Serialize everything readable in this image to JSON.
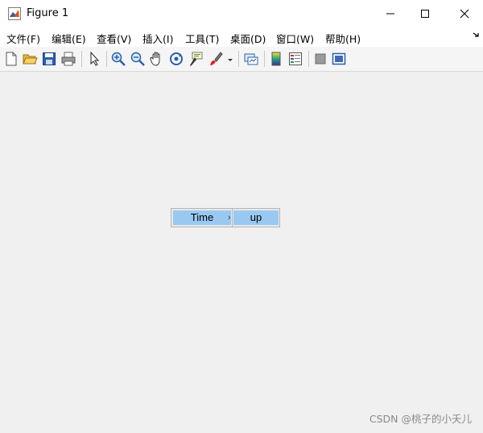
{
  "window": {
    "title": "Figure 1",
    "controls": [
      "minimize",
      "maximize",
      "close"
    ]
  },
  "menubar": {
    "items": [
      {
        "label": "文件(F)"
      },
      {
        "label": "编辑(E)"
      },
      {
        "label": "查看(V)"
      },
      {
        "label": "插入(I)"
      },
      {
        "label": "工具(T)"
      },
      {
        "label": "桌面(D)"
      },
      {
        "label": "窗口(W)"
      },
      {
        "label": "帮助(H)"
      }
    ],
    "overflow_icon": "chevron-icon"
  },
  "toolbar": {
    "buttons": [
      {
        "icon": "new-figure-icon"
      },
      {
        "icon": "open-file-icon"
      },
      {
        "icon": "save-icon"
      },
      {
        "icon": "print-icon"
      },
      {
        "icon": "edit-plot-arrow-icon"
      },
      {
        "icon": "zoom-in-icon"
      },
      {
        "icon": "zoom-out-icon"
      },
      {
        "icon": "pan-hand-icon"
      },
      {
        "icon": "rotate-3d-icon"
      },
      {
        "icon": "data-cursor-icon"
      },
      {
        "icon": "brush-icon"
      },
      {
        "icon": "link-plot-icon"
      },
      {
        "icon": "colorbar-icon"
      },
      {
        "icon": "legend-icon"
      },
      {
        "icon": "hide-plot-tools-icon"
      },
      {
        "icon": "show-plot-tools-icon"
      }
    ]
  },
  "popup": {
    "left_label": "Time",
    "right_label": "up",
    "separator": "›"
  },
  "watermark": "CSDN @桃子的小夭儿",
  "colors": {
    "highlight": "#99c9f1",
    "background": "#f0f0f0",
    "titlebar": "#ffffff"
  }
}
